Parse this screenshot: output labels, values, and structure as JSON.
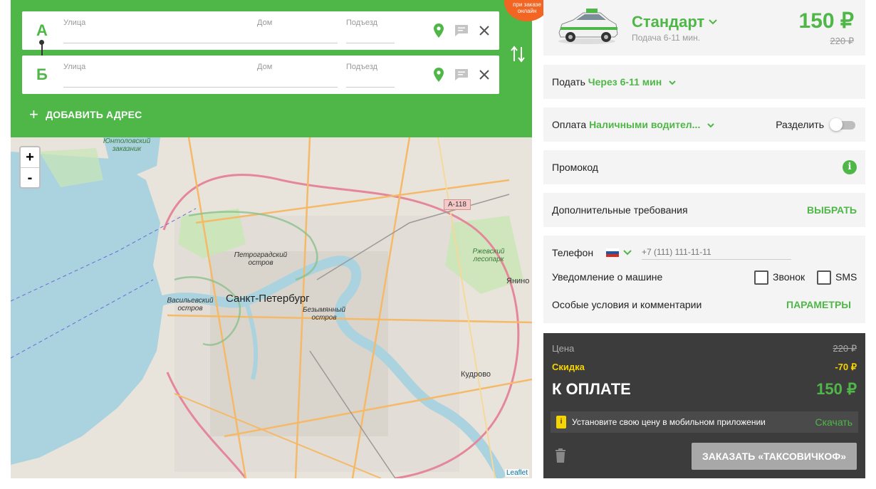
{
  "promo_badge": "при заказе онлайн",
  "route": {
    "point_a": {
      "letter": "А",
      "street_placeholder": "Улица",
      "house_placeholder": "Дом",
      "entrance_placeholder": "Подъезд"
    },
    "point_b": {
      "letter": "Б",
      "street_placeholder": "Улица",
      "house_placeholder": "Дом",
      "entrance_placeholder": "Подъезд"
    },
    "add_address_label": "ДОБАВИТЬ АДРЕС"
  },
  "map": {
    "zoom_in": "+",
    "zoom_out": "-",
    "attribution": "Leaflet",
    "labels": {
      "city": "Санкт-Петербург",
      "petrogradsky": "Петроградский остров",
      "vasilyevsky": "Васильевский остров",
      "bezymyanny": "Безымянный остров",
      "yuntolovsky": "Юнтоловский заказник",
      "rzhevsky": "Ржевский лесопарк",
      "kudrovo": "Кудрово",
      "yanino": "Янино",
      "road": "А-118"
    }
  },
  "tariff": {
    "name": "Стандарт",
    "subtitle": "Подача 6-11 мин.",
    "price": "150 ₽",
    "old_price": "220 ₽"
  },
  "pickup": {
    "label": "Подать",
    "value": "Через 6-11 мин"
  },
  "payment": {
    "label": "Оплата",
    "value": "Наличными водител...",
    "split_label": "Разделить",
    "split_on": false
  },
  "promo": {
    "label": "Промокод",
    "info_icon": "i"
  },
  "extras": {
    "label": "Дополнительные требования",
    "action": "ВЫБРАТЬ"
  },
  "contact": {
    "phone_label": "Телефон",
    "phone_placeholder": "+7 (111) 111-11-11",
    "notify_label": "Уведомление о машине",
    "call_label": "Звонок",
    "sms_label": "SMS",
    "conditions_label": "Особые условия и комментарии",
    "conditions_action": "ПАРАМЕТРЫ"
  },
  "summary": {
    "price_label": "Цена",
    "price_value": "220 ₽",
    "discount_label": "Скидка",
    "discount_value": "-70 ₽",
    "total_label": "К ОПЛАТЕ",
    "total_value": "150 ₽",
    "tip_text": "Установите свою цену в мобильном приложении",
    "tip_action": "Скачать",
    "order_button": "ЗАКАЗАТЬ «ТАКСОВИЧКОФ»"
  },
  "colors": {
    "accent": "#4fb748",
    "badge": "#f26522",
    "summary_bg": "#3c3c3c",
    "discount": "#f5d400"
  }
}
